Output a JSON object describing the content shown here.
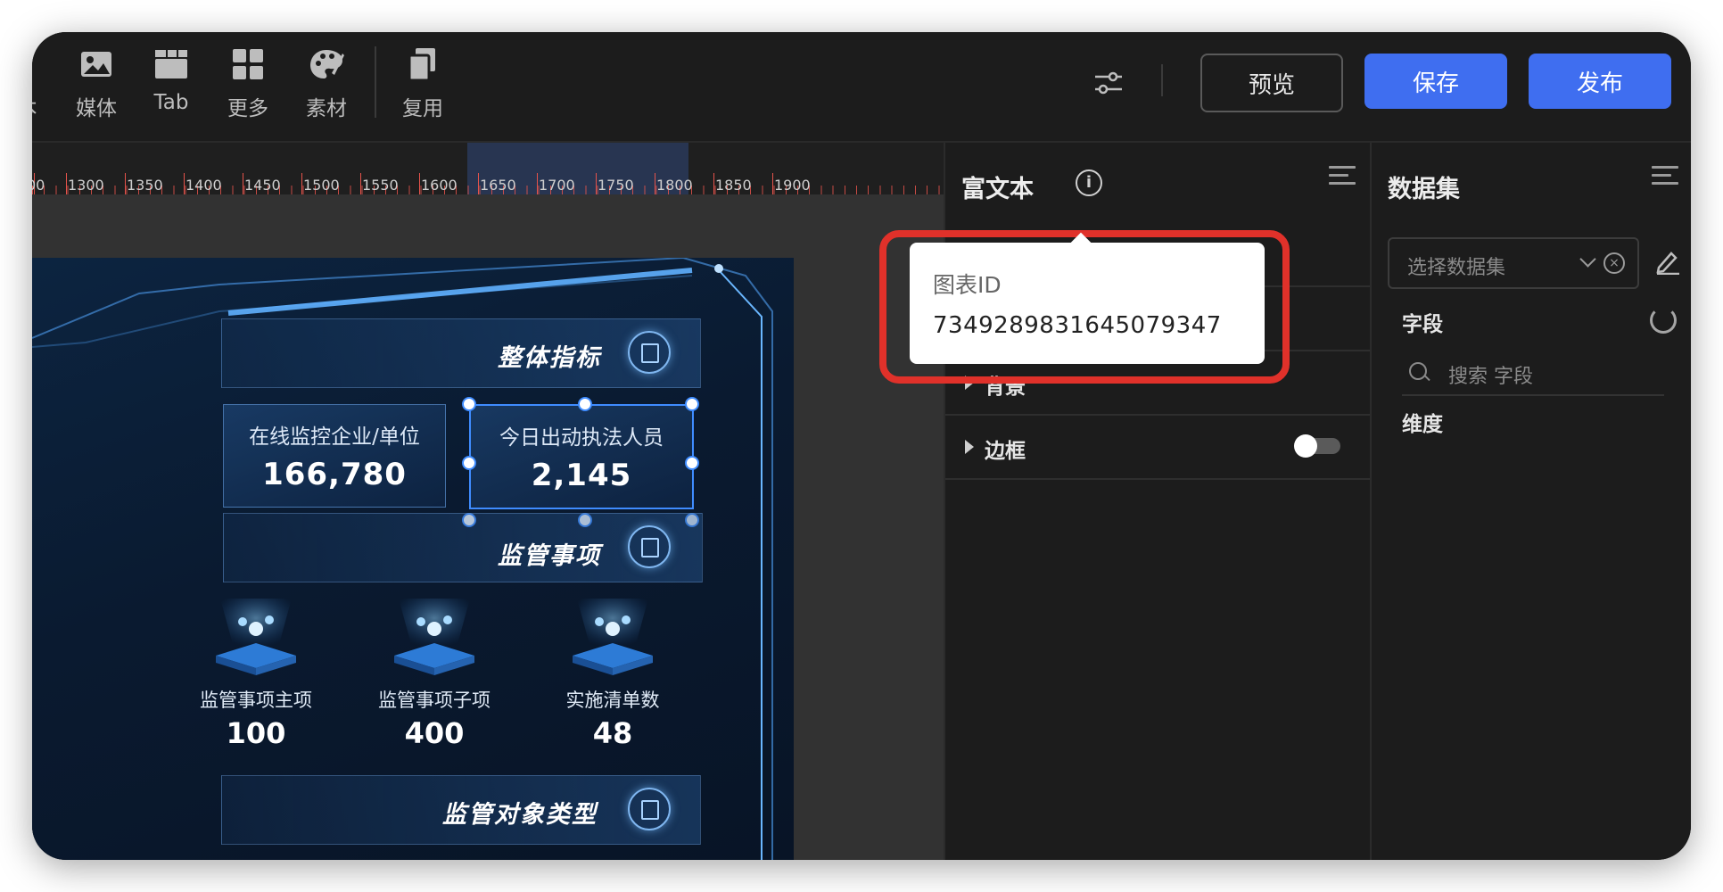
{
  "toolbar": {
    "tools": [
      {
        "label": "本",
        "icon": "text-icon"
      },
      {
        "label": "媒体",
        "icon": "image-icon"
      },
      {
        "label": "Tab",
        "icon": "tab-icon"
      },
      {
        "label": "更多",
        "icon": "grid-icon"
      },
      {
        "label": "素材",
        "icon": "palette-icon"
      },
      {
        "label": "复用",
        "icon": "copy-icon"
      }
    ],
    "preview_label": "预览",
    "save_label": "保存",
    "publish_label": "发布"
  },
  "ruler": {
    "labels": [
      "00",
      "1300",
      "1350",
      "1400",
      "1450",
      "1500",
      "1550",
      "1600",
      "1650",
      "1700",
      "1750",
      "1800",
      "1850",
      "1900"
    ]
  },
  "board": {
    "section1_title": "整体指标",
    "stats": [
      {
        "label": "在线监控企业/单位",
        "value": "166,780"
      },
      {
        "label": "今日出动执法人员",
        "value": "2,145"
      }
    ],
    "section2_title": "监管事项",
    "items": [
      {
        "label": "监管事项主项",
        "value": "100"
      },
      {
        "label": "监管事项子项",
        "value": "400"
      },
      {
        "label": "实施清单数",
        "value": "48"
      }
    ],
    "section3_title": "监管对象类型"
  },
  "prop_panel": {
    "title": "富文本",
    "info_icon": "i",
    "rows": [
      {
        "label": "背景"
      },
      {
        "label": "边框"
      }
    ]
  },
  "tooltip": {
    "label": "图表ID",
    "value": "7349289831645079347"
  },
  "data_panel": {
    "title": "数据集",
    "select_placeholder": "选择数据集",
    "fields_label": "字段",
    "search_placeholder": "搜索 字段",
    "dimension_label": "维度"
  },
  "colors": {
    "accent": "#3f6ef0",
    "highlight": "#e0312a",
    "ruler_tick": "#e5534b"
  }
}
